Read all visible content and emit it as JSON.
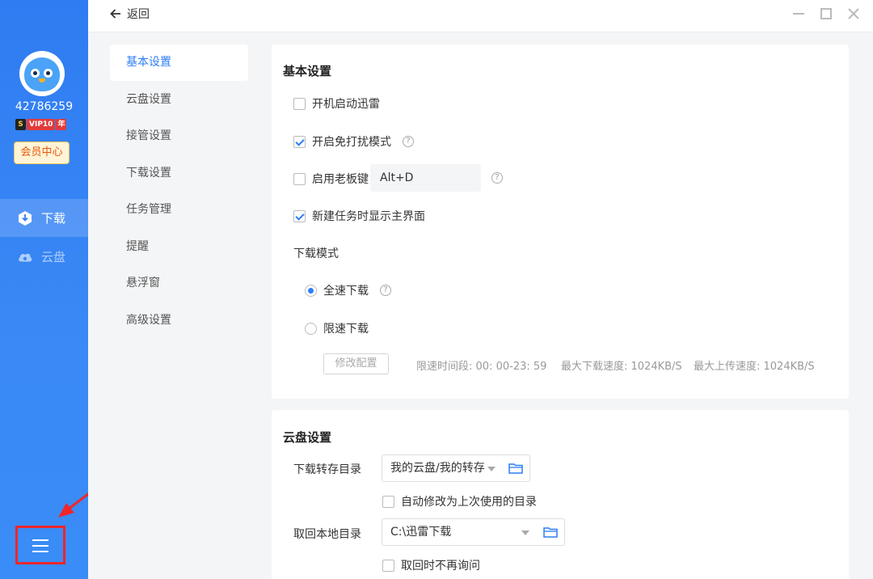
{
  "user": {
    "id": "42786259",
    "vip_badge_letter": "S",
    "vip_label": "VIP10",
    "vip_period": "年",
    "member_center": "会员中心"
  },
  "nav": {
    "download": "下载",
    "cloud": "云盘"
  },
  "titlebar": {
    "back": "返回"
  },
  "settings_menu": [
    "基本设置",
    "云盘设置",
    "接管设置",
    "下载设置",
    "任务管理",
    "提醒",
    "悬浮窗",
    "高级设置"
  ],
  "basic": {
    "title": "基本设置",
    "startup": "开机启动迅雷",
    "dnd": "开启免打扰模式",
    "boss_key": "启用老板键",
    "boss_key_value": "Alt+D",
    "show_main": "新建任务时显示主界面",
    "mode_label": "下载模式",
    "full_speed": "全速下载",
    "limited": "限速下载",
    "modify_btn": "修改配置",
    "limit_period": "限速时间段:   00: 00-23: 59",
    "limit_down": "最大下载速度: 1024KB/S",
    "limit_up": "最大上传速度: 1024KB/S"
  },
  "cloud": {
    "title": "云盘设置",
    "transfer_dir_label": "下载转存目录",
    "transfer_dir_value": "我的云盘/我的转存",
    "auto_modify": "自动修改为上次使用的目录",
    "local_dir_label": "取回本地目录",
    "local_dir_value": "C:\\迅雷下载",
    "no_ask": "取回时不再询问"
  },
  "colors": {
    "accent": "#2b7ef6",
    "sidebar": "#2f7cf2",
    "annotation": "#f2262b"
  }
}
